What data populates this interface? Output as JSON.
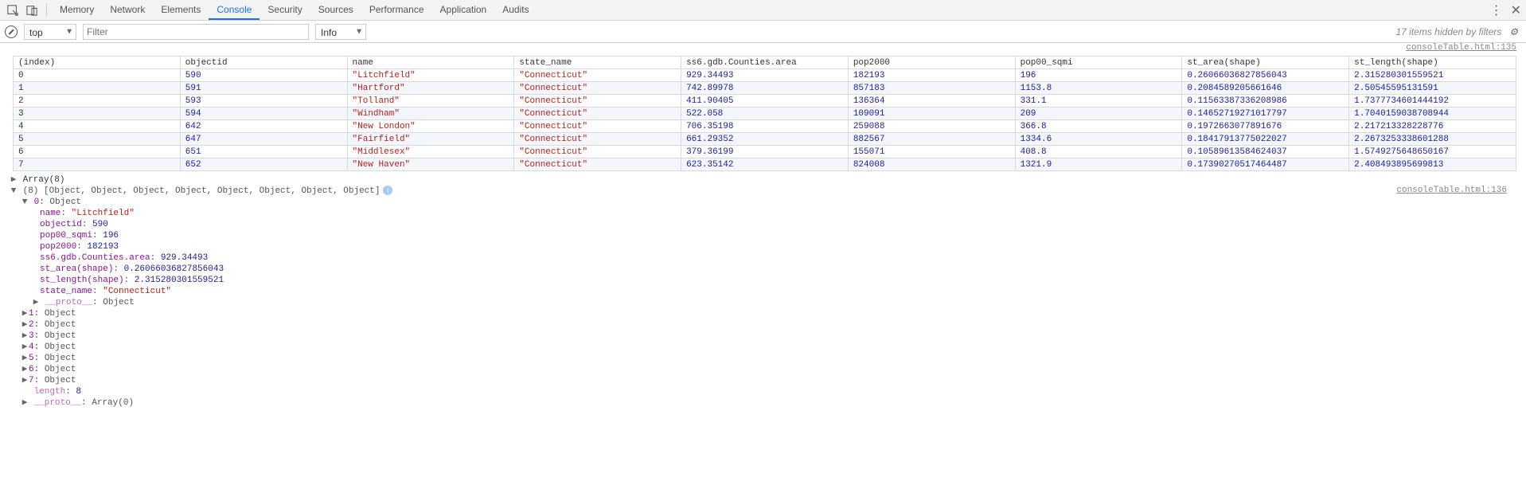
{
  "tabs": [
    "Memory",
    "Network",
    "Elements",
    "Console",
    "Security",
    "Sources",
    "Performance",
    "Application",
    "Audits"
  ],
  "active_tab": "Console",
  "toolbar": {
    "context": "top",
    "filter_placeholder": "Filter",
    "level": "Info",
    "hidden_text": "17 items hidden by filters"
  },
  "source_link_1": "consoleTable.html:135",
  "source_link_2": "consoleTable.html:136",
  "table": {
    "headers": [
      "(index)",
      "objectid",
      "name",
      "state_name",
      "ss6.gdb.Counties.area",
      "pop2000",
      "pop00_sqmi",
      "st_area(shape)",
      "st_length(shape)"
    ],
    "rows": [
      {
        "index": "0",
        "objectid": "590",
        "name": "\"Litchfield\"",
        "state_name": "\"Connecticut\"",
        "area": "929.34493",
        "pop2000": "182193",
        "pop00_sqmi": "196",
        "st_area": "0.26066036827856043",
        "st_length": "2.315280301559521"
      },
      {
        "index": "1",
        "objectid": "591",
        "name": "\"Hartford\"",
        "state_name": "\"Connecticut\"",
        "area": "742.89978",
        "pop2000": "857183",
        "pop00_sqmi": "1153.8",
        "st_area": "0.2084589205661646",
        "st_length": "2.50545595131591"
      },
      {
        "index": "2",
        "objectid": "593",
        "name": "\"Tolland\"",
        "state_name": "\"Connecticut\"",
        "area": "411.90405",
        "pop2000": "136364",
        "pop00_sqmi": "331.1",
        "st_area": "0.11563387336208986",
        "st_length": "1.7377734601444192"
      },
      {
        "index": "3",
        "objectid": "594",
        "name": "\"Windham\"",
        "state_name": "\"Connecticut\"",
        "area": "522.058",
        "pop2000": "109091",
        "pop00_sqmi": "209",
        "st_area": "0.14652719271017797",
        "st_length": "1.7040159038708944"
      },
      {
        "index": "4",
        "objectid": "642",
        "name": "\"New London\"",
        "state_name": "\"Connecticut\"",
        "area": "706.35198",
        "pop2000": "259088",
        "pop00_sqmi": "366.8",
        "st_area": "0.1972663077891676",
        "st_length": "2.217213328228776"
      },
      {
        "index": "5",
        "objectid": "647",
        "name": "\"Fairfield\"",
        "state_name": "\"Connecticut\"",
        "area": "661.29352",
        "pop2000": "882567",
        "pop00_sqmi": "1334.6",
        "st_area": "0.18417913775022027",
        "st_length": "2.2673253338601288"
      },
      {
        "index": "6",
        "objectid": "651",
        "name": "\"Middlesex\"",
        "state_name": "\"Connecticut\"",
        "area": "379.36199",
        "pop2000": "155071",
        "pop00_sqmi": "408.8",
        "st_area": "0.10589613584624037",
        "st_length": "1.5749275648650167"
      },
      {
        "index": "7",
        "objectid": "652",
        "name": "\"New Haven\"",
        "state_name": "\"Connecticut\"",
        "area": "623.35142",
        "pop2000": "824008",
        "pop00_sqmi": "1321.9",
        "st_area": "0.17390270517464487",
        "st_length": "2.408493895699813"
      }
    ]
  },
  "array_summary": "Array(8)",
  "array_preview": "(8) [Object, Object, Object, Object, Object, Object, Object, Object]",
  "expanded0": {
    "label": "0:",
    "type": "Object",
    "props": [
      {
        "k": "name",
        "v": "\"Litchfield\"",
        "cls": "c-str"
      },
      {
        "k": "objectid",
        "v": "590",
        "cls": "c-num"
      },
      {
        "k": "pop00_sqmi",
        "v": "196",
        "cls": "c-num"
      },
      {
        "k": "pop2000",
        "v": "182193",
        "cls": "c-num"
      },
      {
        "k": "ss6.gdb.Counties.area",
        "v": "929.34493",
        "cls": "c-num"
      },
      {
        "k": "st_area(shape)",
        "v": "0.26066036827856043",
        "cls": "c-num"
      },
      {
        "k": "st_length(shape)",
        "v": "2.315280301559521",
        "cls": "c-num"
      },
      {
        "k": "state_name",
        "v": "\"Connecticut\"",
        "cls": "c-str"
      }
    ],
    "proto_label": "__proto__",
    "proto_value": "Object"
  },
  "collapsed_items": [
    {
      "k": "1",
      "v": "Object"
    },
    {
      "k": "2",
      "v": "Object"
    },
    {
      "k": "3",
      "v": "Object"
    },
    {
      "k": "4",
      "v": "Object"
    },
    {
      "k": "5",
      "v": "Object"
    },
    {
      "k": "6",
      "v": "Object"
    },
    {
      "k": "7",
      "v": "Object"
    }
  ],
  "length_label": "length",
  "length_value": "8",
  "proto2_label": "__proto__",
  "proto2_value": "Array(0)",
  "chart_data": {
    "type": "table",
    "title": "console.table output",
    "columns": [
      "(index)",
      "objectid",
      "name",
      "state_name",
      "ss6.gdb.Counties.area",
      "pop2000",
      "pop00_sqmi",
      "st_area(shape)",
      "st_length(shape)"
    ],
    "rows": [
      [
        0,
        590,
        "Litchfield",
        "Connecticut",
        929.34493,
        182193,
        196,
        0.26066036827856043,
        2.315280301559521
      ],
      [
        1,
        591,
        "Hartford",
        "Connecticut",
        742.89978,
        857183,
        1153.8,
        0.2084589205661646,
        2.50545595131591
      ],
      [
        2,
        593,
        "Tolland",
        "Connecticut",
        411.90405,
        136364,
        331.1,
        0.11563387336208986,
        1.7377734601444192
      ],
      [
        3,
        594,
        "Windham",
        "Connecticut",
        522.058,
        109091,
        209,
        0.14652719271017797,
        1.7040159038708944
      ],
      [
        4,
        642,
        "New London",
        "Connecticut",
        706.35198,
        259088,
        366.8,
        0.1972663077891676,
        2.217213328228776
      ],
      [
        5,
        647,
        "Fairfield",
        "Connecticut",
        661.29352,
        882567,
        1334.6,
        0.18417913775022027,
        2.267325333860129
      ],
      [
        6,
        651,
        "Middlesex",
        "Connecticut",
        379.36199,
        155071,
        408.8,
        0.10589613584624037,
        1.5749275648650167
      ],
      [
        7,
        652,
        "New Haven",
        "Connecticut",
        623.35142,
        824008,
        1321.9,
        0.17390270517464487,
        2.408493895699813
      ]
    ]
  }
}
